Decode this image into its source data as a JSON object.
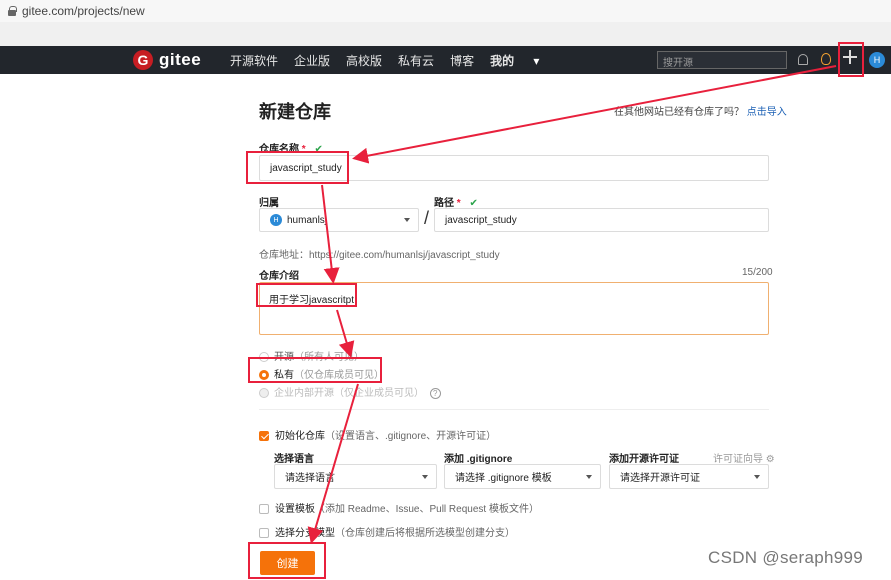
{
  "browser": {
    "url": "gitee.com/projects/new"
  },
  "nav": {
    "logo_mark": "G",
    "logo_text": "gitee",
    "links": [
      "开源软件",
      "企业版",
      "高校版",
      "私有云",
      "博客"
    ],
    "mine": "我的",
    "search_placeholder": "搜开源",
    "avatar_initial": "H"
  },
  "page": {
    "title": "新建仓库",
    "import_prompt": "在其他网站已经有仓库了吗？",
    "import_link": "点击导入"
  },
  "form": {
    "repo_name_label": "仓库名称",
    "repo_name_value": "javascript_study",
    "owner_label": "归属",
    "owner_avatar": "H",
    "owner_value": "humanlsj",
    "slash": "/",
    "path_label": "路径",
    "path_value": "javascript_study",
    "repo_address": "仓库地址：https://gitee.com/humanlsj/javascript_study",
    "intro_label": "仓库介绍",
    "intro_counter": "15/200",
    "intro_value": "用于学习javascritpt",
    "required_mark": "*",
    "check_mark": "✔",
    "visibility": [
      {
        "label": "开源",
        "hint": "（所有人可见）",
        "selected": false
      },
      {
        "label": "私有",
        "hint": "（仅仓库成员可见）",
        "selected": true
      },
      {
        "label": "企业内部开源",
        "hint": "（仅企业成员可见）",
        "selected": false
      }
    ],
    "help_icon": "?",
    "init_repo_label": "初始化仓库",
    "init_repo_hint": "（设置语言、.gitignore、开源许可证）",
    "init_repo_checked": true,
    "language_label": "选择语言",
    "language_placeholder": "请选择语言",
    "gitignore_label": "添加 .gitignore",
    "gitignore_placeholder": "请选择 .gitignore 模板",
    "license_label": "添加开源许可证",
    "license_guide": "许可证向导",
    "license_placeholder": "请选择开源许可证",
    "template_label": "设置模板",
    "template_hint": "（添加 Readme、Issue、Pull Request 模板文件）",
    "branch_label": "选择分支模型",
    "branch_hint": "（仓库创建后将根据所选模型创建分支）",
    "create_button": "创建"
  },
  "watermark": "CSDN @seraph999",
  "colors": {
    "accent": "#f5720a",
    "annotation": "#e8203c",
    "nav_bg": "#22262c",
    "brand": "#c71d23"
  }
}
